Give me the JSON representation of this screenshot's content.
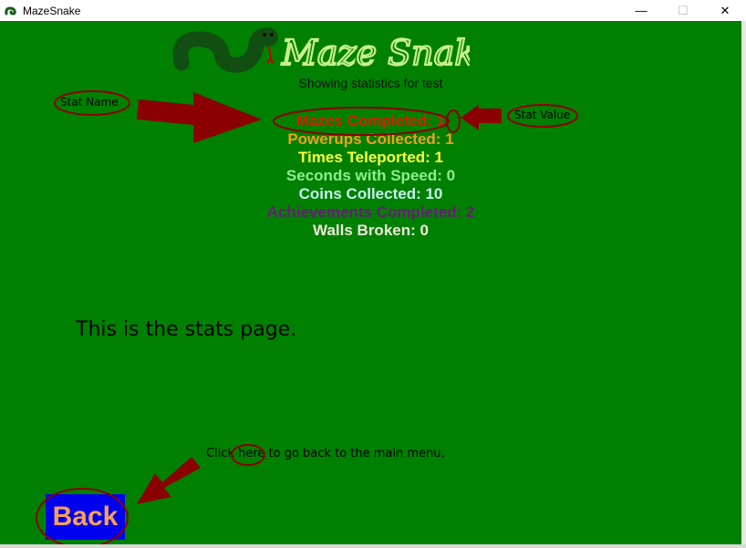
{
  "window": {
    "title": "MazeSnake",
    "controls": {
      "minimize": "—",
      "maximize": "☐",
      "close": "✕"
    }
  },
  "header": {
    "logo_text": "Maze Snake",
    "subtitle": "Showing statistics for test"
  },
  "stats": [
    {
      "label": "Mazes Completed: 1",
      "color": "#d42000"
    },
    {
      "label": "Powerups Collected: 1",
      "color": "#f0a020"
    },
    {
      "label": "Times Teleported: 1",
      "color": "#ffff40"
    },
    {
      "label": "Seconds with Speed: 0",
      "color": "#90ee90"
    },
    {
      "label": "Coins Collected: 10",
      "color": "#c8f0f0"
    },
    {
      "label": "Achievements Completed: 2",
      "color": "#6a1a7a"
    },
    {
      "label": "Walls Broken: 0",
      "color": "#f0e8dc"
    }
  ],
  "body": {
    "description": "This is the stats page.",
    "click_prefix": "Click ",
    "click_link": "here",
    "click_suffix": " to go back to the main menu."
  },
  "back_button": {
    "label": "Back"
  },
  "annotations": {
    "stat_name": "Stat Name",
    "stat_value": "Stat Value",
    "color": "#8b0000"
  },
  "colors": {
    "background": "#008000",
    "back_button_bg": "#0000ee",
    "back_button_text": "#f5a05a"
  }
}
